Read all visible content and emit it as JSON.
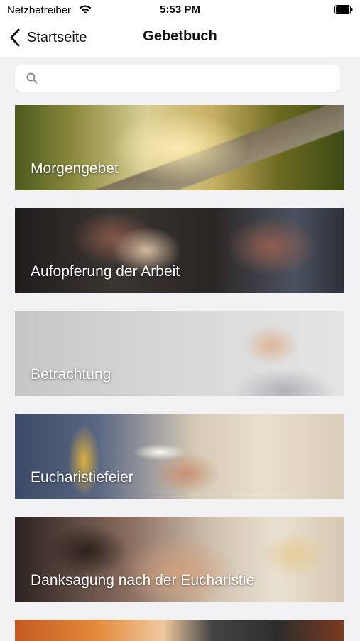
{
  "status_bar": {
    "carrier": "Netzbetreiber",
    "time": "5:53 PM"
  },
  "nav": {
    "back_label": "Startseite",
    "title": "Gebetbuch"
  },
  "search": {
    "placeholder": "",
    "value": ""
  },
  "cards": [
    {
      "label": "Morgengebet"
    },
    {
      "label": "Aufopferung der Arbeit"
    },
    {
      "label": "Betrachtung"
    },
    {
      "label": "Eucharistiefeier"
    },
    {
      "label": "Danksagung nach der Eucharistie"
    },
    {
      "label": ""
    }
  ]
}
